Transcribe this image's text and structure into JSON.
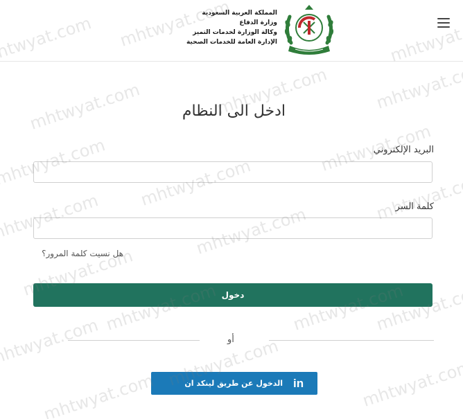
{
  "header": {
    "org_lines": [
      "المملكة العربية السعودية",
      "وزارة الدفاع",
      "وكالة الوزارة لخدمات التميز",
      "الإدارة العامة للخدمات الصحية"
    ],
    "menu_icon": "hamburger-icon",
    "logo": "ministry-emblem"
  },
  "form": {
    "title": "ادخل الى النظام",
    "email_label": "البريد الإلكتروني",
    "email_value": "",
    "password_label": "كلمة السر",
    "password_value": "",
    "forgot_link": "هل نسيت كلمة المرور؟",
    "login_button": "دخول",
    "or_text": "أو",
    "linkedin_button": "الدخول عن طريق لينكد ان",
    "linkedin_icon": "in"
  },
  "colors": {
    "login_button": "#21735e",
    "linkedin_button": "#1b7ab8",
    "emblem_green": "#2f7d3a",
    "emblem_red": "#c0282d"
  },
  "watermark": "mhtwyat.com"
}
